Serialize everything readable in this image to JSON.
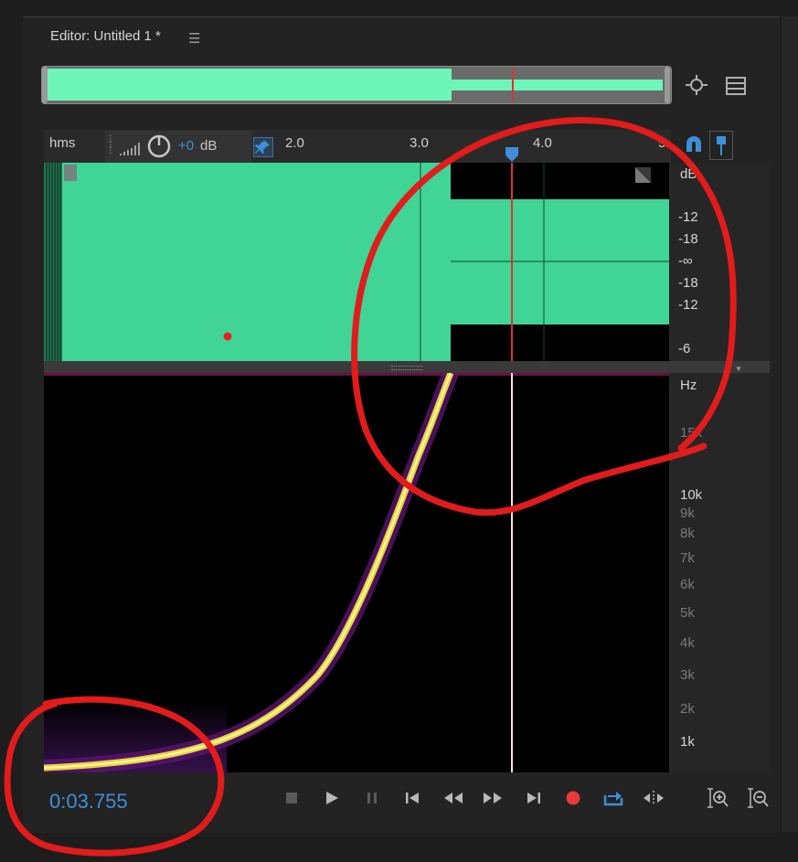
{
  "editor": {
    "title": "Editor: Untitled 1 *",
    "menu_icon": "hamburger-menu-icon"
  },
  "timeline": {
    "units_label": "hms",
    "gain_label": "+0",
    "gain_unit": "dB",
    "ticks": [
      "2.0",
      "3.0",
      "4.0",
      "5"
    ]
  },
  "amplitude_scale": {
    "unit": "dB",
    "labels": [
      "-12",
      "-18",
      "-∞",
      "-18",
      "-12",
      "-6"
    ]
  },
  "frequency_scale": {
    "unit": "Hz",
    "labels": [
      "15k",
      "10k",
      "9k",
      "8k",
      "7k",
      "6k",
      "5k",
      "4k",
      "3k",
      "2k",
      "1k"
    ]
  },
  "transport": {
    "time": "0:03.755",
    "buttons": [
      "stop-icon",
      "play-icon",
      "pause-icon",
      "skip-start-icon",
      "rewind-icon",
      "fast-forward-icon",
      "skip-end-icon",
      "record-icon",
      "loop-icon",
      "skip-selection-icon"
    ]
  },
  "colors": {
    "waveform": "#40d496",
    "overview_waveform": "#6ef5b8",
    "playhead": "#e03030",
    "annotation": "#e21b1b",
    "timecode": "#3d8fd9"
  }
}
